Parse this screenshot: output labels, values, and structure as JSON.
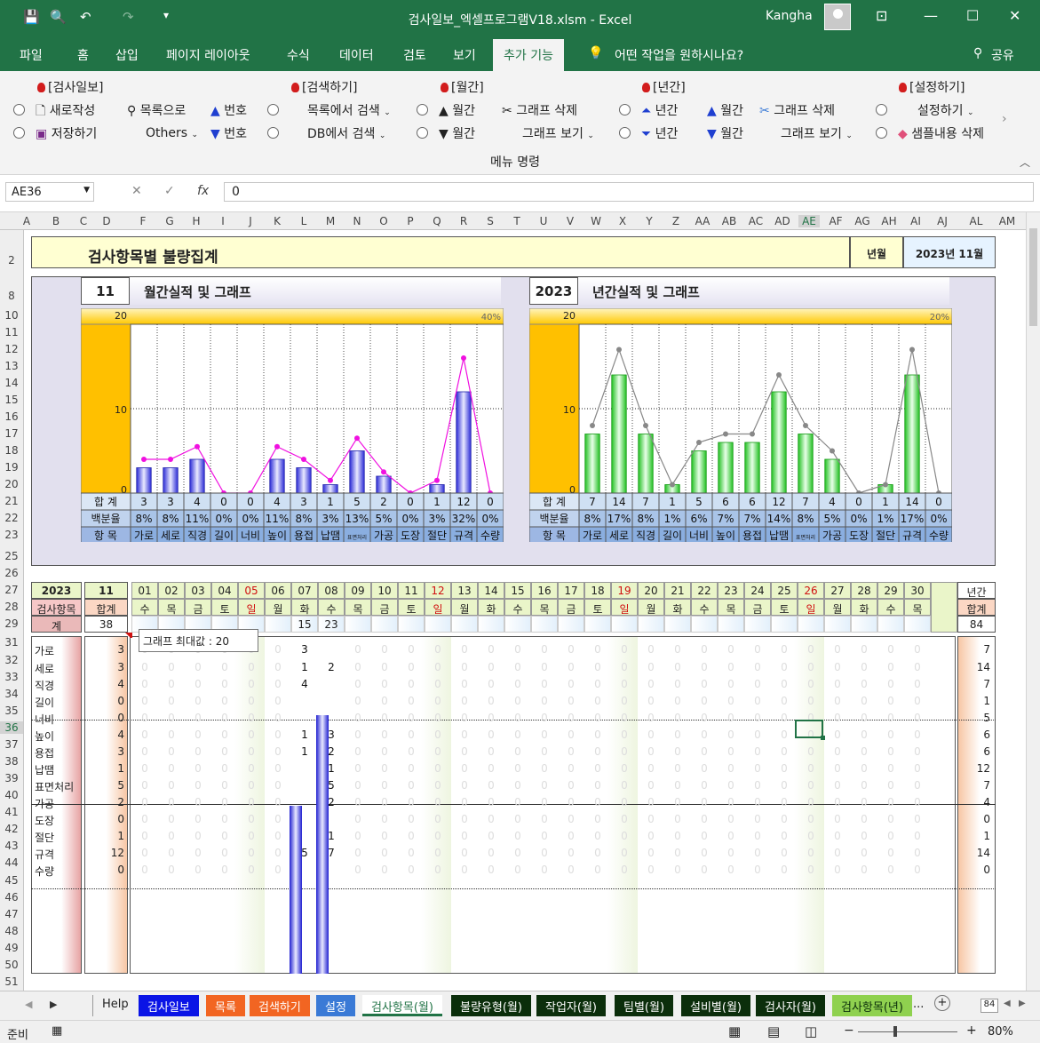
{
  "window": {
    "title": "검사일보_엑셀프로그램V18.xlsm  -  Excel",
    "user": "Kangha"
  },
  "ribbon_tabs": [
    "파일",
    "홈",
    "삽입",
    "페이지 레이아웃",
    "수식",
    "데이터",
    "검토",
    "보기",
    "추가 기능"
  ],
  "active_tab": "추가 기능",
  "tell_me": "어떤 작업을 원하시나요?",
  "share": "공유",
  "ribbon": {
    "group_label": "메뉴 명령",
    "g1": {
      "title": "[검사일보]",
      "new": "새로작성",
      "save": "저장하기",
      "to_list": "목록으로",
      "others": "Others",
      "num1": "번호",
      "num2": "번호"
    },
    "g2": {
      "title": "[검색하기]",
      "list_search": "목록에서 검색",
      "db_search": "DB에서 검색"
    },
    "g3": {
      "title": "[월간]",
      "m1": "월간",
      "m2": "월간",
      "del_graph": "그래프 삭제",
      "view_graph": "그래프 보기"
    },
    "g4": {
      "title": "[년간]",
      "y1": "년간",
      "y2": "년간",
      "m1": "월간",
      "m2": "월간",
      "del_graph": "그래프 삭제",
      "view_graph": "그래프 보기"
    },
    "g5": {
      "title": "[설정하기]",
      "settings": "설정하기",
      "del_sample": "샘플내용 삭제"
    }
  },
  "formula_bar": {
    "name_box": "AE36",
    "value": "0",
    "fx": "fx"
  },
  "columns": [
    "A",
    "B",
    "C",
    "D",
    "F",
    "G",
    "H",
    "I",
    "J",
    "K",
    "L",
    "M",
    "N",
    "O",
    "P",
    "Q",
    "R",
    "S",
    "T",
    "U",
    "V",
    "W",
    "X",
    "Y",
    "Z",
    "AA",
    "AB",
    "AC",
    "AD",
    "AE",
    "AF",
    "AG",
    "AH",
    "AI",
    "AJ",
    "AL",
    "AM"
  ],
  "rows": [
    "2",
    "8",
    "10",
    "11",
    "12",
    "13",
    "14",
    "15",
    "16",
    "17",
    "18",
    "19",
    "20",
    "21",
    "22",
    "23",
    "25",
    "26",
    "27",
    "28",
    "29",
    "31",
    "32",
    "33",
    "34",
    "35",
    "36",
    "37",
    "38",
    "39",
    "40",
    "41",
    "42",
    "43",
    "44",
    "45",
    "46",
    "47",
    "48",
    "49",
    "50",
    "51"
  ],
  "report": {
    "title": "검사항목별 불량집계",
    "ym_label": "년월",
    "ym_value": "2023년 11월"
  },
  "monthly_chart": {
    "month": "11",
    "title": "월간실적 및 그래프",
    "pct_label": "40%",
    "row_labels": {
      "total": "합 계",
      "pct": "백분율",
      "item": "항 목"
    }
  },
  "yearly_chart": {
    "year": "2023",
    "title": "년간실적 및 그래프",
    "pct_label": "20%",
    "row_labels": {
      "total": "합 계",
      "pct": "백분율",
      "item": "항 목"
    }
  },
  "chart_data": [
    {
      "type": "bar",
      "title": "월간실적 및 그래프",
      "categories": [
        "가로",
        "세로",
        "직경",
        "길이",
        "너비",
        "높이",
        "용접",
        "납땜",
        "표면처리",
        "가공",
        "도장",
        "절단",
        "규격",
        "수량"
      ],
      "series": [
        {
          "name": "합 계",
          "values": [
            3,
            3,
            4,
            0,
            0,
            4,
            3,
            1,
            5,
            2,
            0,
            1,
            12,
            0
          ]
        }
      ],
      "percent": [
        "8%",
        "8%",
        "11%",
        "0%",
        "0%",
        "11%",
        "8%",
        "3%",
        "13%",
        "5%",
        "0%",
        "3%",
        "32%",
        "0%"
      ],
      "percent_line": [
        8,
        8,
        11,
        0,
        0,
        11,
        8,
        3,
        13,
        5,
        0,
        3,
        32,
        0
      ],
      "ylim": [
        0,
        20
      ],
      "yticks": [
        0,
        10,
        20
      ],
      "y2_max_label": "40%"
    },
    {
      "type": "bar",
      "title": "년간실적 및 그래프",
      "categories": [
        "가로",
        "세로",
        "직경",
        "길이",
        "너비",
        "높이",
        "용접",
        "납땜",
        "표면처리",
        "가공",
        "도장",
        "절단",
        "규격",
        "수량"
      ],
      "series": [
        {
          "name": "합 계",
          "values": [
            7,
            14,
            7,
            1,
            5,
            6,
            6,
            12,
            7,
            4,
            0,
            1,
            14,
            0
          ]
        }
      ],
      "percent": [
        "8%",
        "17%",
        "8%",
        "1%",
        "6%",
        "7%",
        "7%",
        "14%",
        "8%",
        "5%",
        "0%",
        "1%",
        "17%",
        "0%"
      ],
      "percent_line": [
        8,
        17,
        8,
        1,
        6,
        7,
        7,
        14,
        8,
        5,
        0,
        1,
        17,
        0
      ],
      "ylim": [
        0,
        20
      ],
      "yticks": [
        0,
        10,
        20
      ],
      "y2_max_label": "20%"
    }
  ],
  "grid": {
    "year": "2023",
    "month": "11",
    "item_header": "검사항목",
    "total_header": "합계",
    "yearly_header": "년간",
    "yearly_total_header": "합계",
    "sum_label": "계",
    "month_total": "38",
    "year_total": "84",
    "days": [
      "01",
      "02",
      "03",
      "04",
      "05",
      "06",
      "07",
      "08",
      "09",
      "10",
      "11",
      "12",
      "13",
      "14",
      "15",
      "16",
      "17",
      "18",
      "19",
      "20",
      "21",
      "22",
      "23",
      "24",
      "25",
      "26",
      "27",
      "28",
      "29",
      "30"
    ],
    "weekdays": [
      "수",
      "목",
      "금",
      "토",
      "일",
      "월",
      "화",
      "수",
      "목",
      "금",
      "토",
      "일",
      "월",
      "화",
      "수",
      "목",
      "금",
      "토",
      "일",
      "월",
      "화",
      "수",
      "목",
      "금",
      "토",
      "일",
      "월",
      "화",
      "수",
      "목"
    ],
    "holidays": [
      4,
      11,
      18,
      25
    ],
    "day_totals": [
      "",
      "",
      "",
      "",
      "",
      "",
      "15",
      "23",
      "",
      "",
      "",
      "",
      "",
      "",
      "",
      "",
      "",
      "",
      "",
      "",
      "",
      "",
      "",
      "",
      "",
      "",
      "",
      "",
      "",
      ""
    ],
    "items": [
      {
        "name": "가로",
        "total": "3",
        "yearly": "7",
        "d07": "3",
        "d08": ""
      },
      {
        "name": "세로",
        "total": "3",
        "yearly": "14",
        "d07": "1",
        "d08": "2"
      },
      {
        "name": "직경",
        "total": "4",
        "yearly": "7",
        "d07": "4",
        "d08": ""
      },
      {
        "name": "길이",
        "total": "0",
        "yearly": "1",
        "d07": "",
        "d08": ""
      },
      {
        "name": "너비",
        "total": "0",
        "yearly": "5",
        "d07": "",
        "d08": ""
      },
      {
        "name": "높이",
        "total": "4",
        "yearly": "6",
        "d07": "1",
        "d08": "3"
      },
      {
        "name": "용접",
        "total": "3",
        "yearly": "6",
        "d07": "1",
        "d08": "2"
      },
      {
        "name": "납땜",
        "total": "1",
        "yearly": "12",
        "d07": "",
        "d08": "1"
      },
      {
        "name": "표면처리",
        "total": "5",
        "yearly": "7",
        "d07": "",
        "d08": "5"
      },
      {
        "name": "가공",
        "total": "2",
        "yearly": "4",
        "d07": "",
        "d08": "2"
      },
      {
        "name": "도장",
        "total": "0",
        "yearly": "0",
        "d07": "",
        "d08": ""
      },
      {
        "name": "절단",
        "total": "1",
        "yearly": "1",
        "d07": "",
        "d08": "1"
      },
      {
        "name": "규격",
        "total": "12",
        "yearly": "14",
        "d07": "5",
        "d08": "7"
      },
      {
        "name": "수량",
        "total": "0",
        "yearly": "0",
        "d07": "",
        "d08": ""
      }
    ],
    "zero": "0",
    "tooltip": "그래프 최대값 : 20"
  },
  "sheet_tabs": [
    {
      "label": "Help",
      "color": "#f0f0f0",
      "text": "#222"
    },
    {
      "label": "검사일보",
      "color": "#0a14e6",
      "text": "#ffffff"
    },
    {
      "label": "목록",
      "color": "#f26522",
      "text": "#ffffff"
    },
    {
      "label": "검색하기",
      "color": "#f26522",
      "text": "#ffffff"
    },
    {
      "label": "설정",
      "color": "#3a7ad6",
      "text": "#ffffff"
    },
    {
      "label": "검사항목(월)",
      "color": "#ffffff",
      "text": "#217346"
    },
    {
      "label": "불량유형(월)",
      "color": "#0b2e0b",
      "text": "#ffffff"
    },
    {
      "label": "작업자(월)",
      "color": "#0b2e0b",
      "text": "#ffffff"
    },
    {
      "label": "팀별(월)",
      "color": "#0b2e0b",
      "text": "#ffffff"
    },
    {
      "label": "설비별(월)",
      "color": "#0b2e0b",
      "text": "#ffffff"
    },
    {
      "label": "검사자(월)",
      "color": "#0b2e0b",
      "text": "#ffffff"
    },
    {
      "label": "검사항목(년)",
      "color": "#8fd14f",
      "text": "#0b2e0b"
    }
  ],
  "tab_more": "...",
  "hscroll_value": "84",
  "status": {
    "ready": "준비",
    "zoom": "80%"
  }
}
